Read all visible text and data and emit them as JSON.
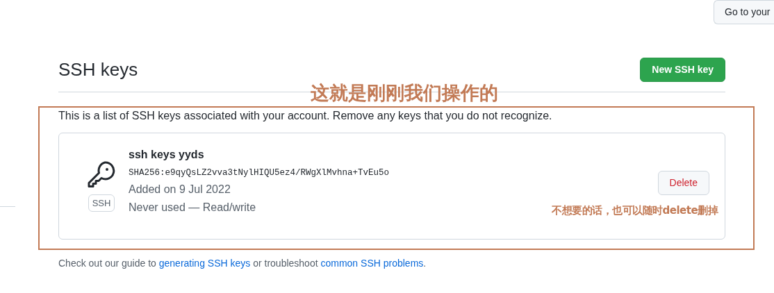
{
  "top_button": {
    "label": "Go to your"
  },
  "header": {
    "title": "SSH keys",
    "new_button": "New SSH key"
  },
  "description": "This is a list of SSH keys associated with your account. Remove any keys that you do not recognize.",
  "keys": [
    {
      "title": "ssh keys yyds",
      "fingerprint": "SHA256:e9qyQsLZ2vva3tNylHIQU5ez4/RWgXlMvhna+TvEu5o",
      "badge": "SSH",
      "added": "Added on 9 Jul 2022",
      "usage": "Never used — Read/write",
      "delete_button": "Delete"
    }
  ],
  "footer": [
    {
      "kind": "text",
      "text": "Check out our guide to "
    },
    {
      "kind": "link",
      "text": "generating SSH keys"
    },
    {
      "kind": "text",
      "text": " or troubleshoot "
    },
    {
      "kind": "link",
      "text": "common SSH problems"
    },
    {
      "kind": "text",
      "text": "."
    }
  ],
  "annotations": [
    {
      "kind": "heading",
      "text": "这就是刚刚我们操作的"
    },
    {
      "kind": "note",
      "text": "不想要的话，也可以随时delete删掉"
    }
  ]
}
